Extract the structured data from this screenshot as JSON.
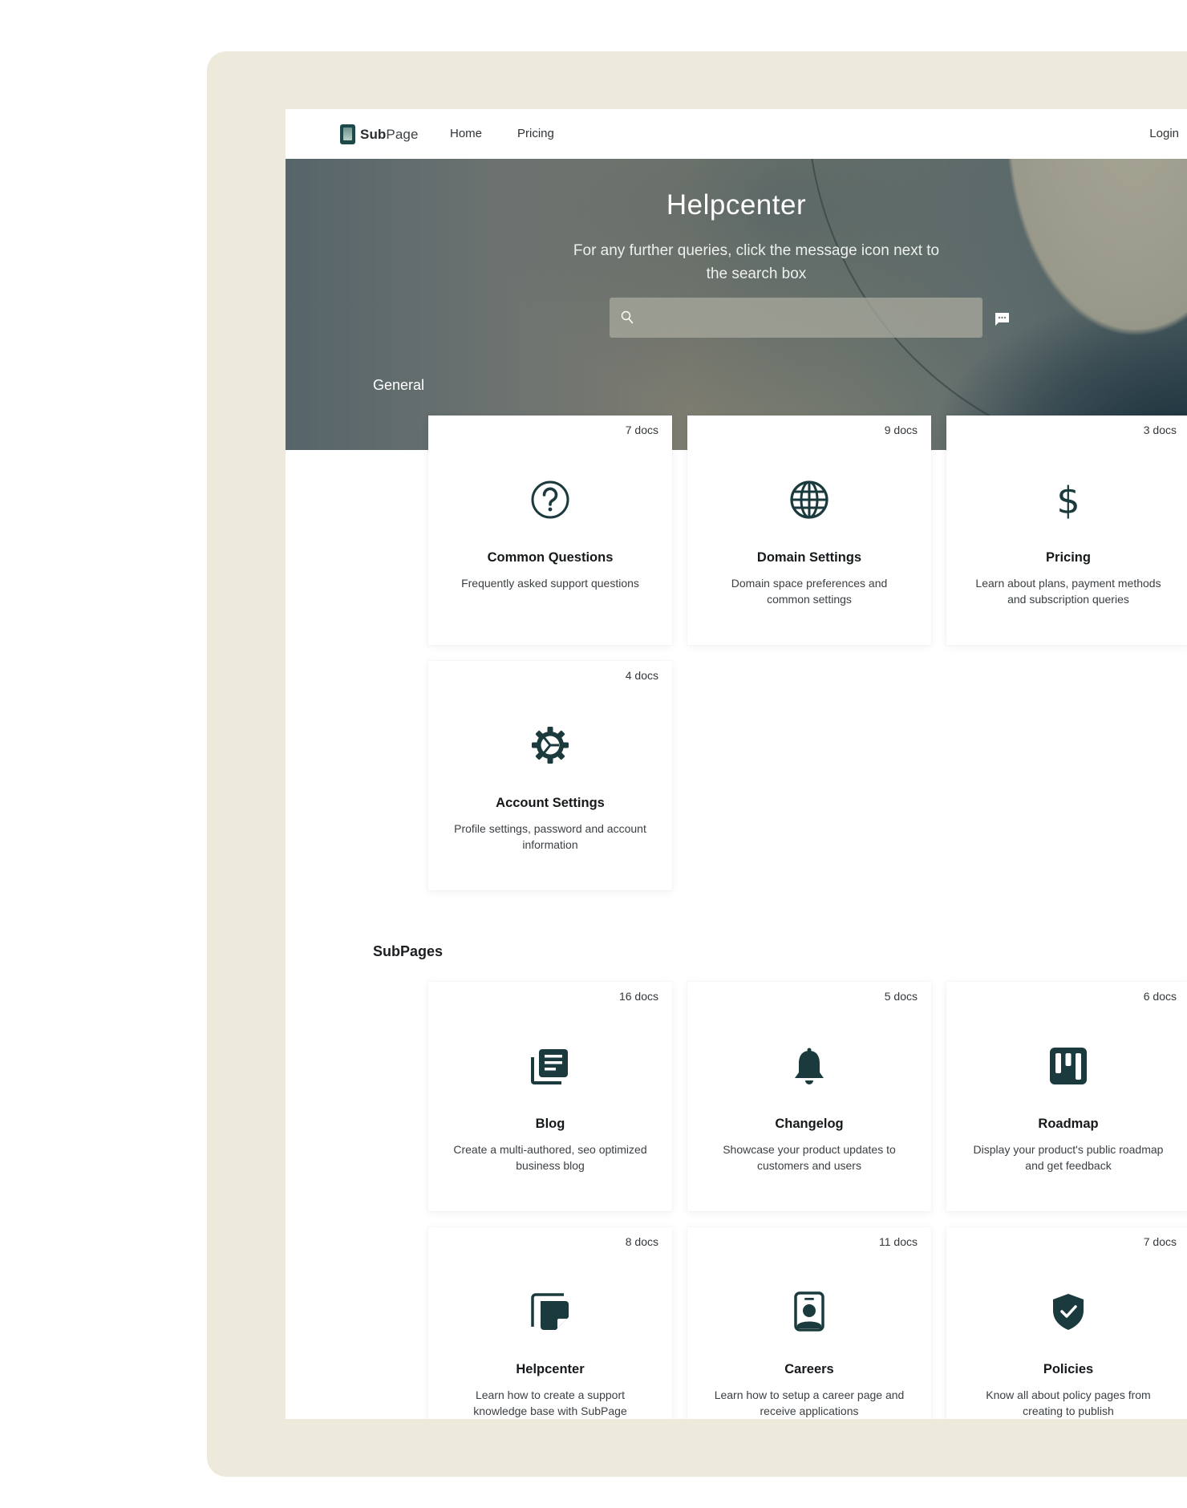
{
  "nav": {
    "logo_bold": "Sub",
    "logo_light": "Page",
    "links": [
      "Home",
      "Pricing"
    ],
    "login": "Login"
  },
  "hero": {
    "title": "Helpcenter",
    "subtitle": "For any further queries, click the message icon next to the search box",
    "search_placeholder": "",
    "search_value": "",
    "search_icon": "search-icon",
    "message_icon": "message-icon"
  },
  "colors": {
    "frame": "#eeeadb",
    "icon": "#1b3a3d",
    "logo": "#1c4a4b"
  },
  "sections": [
    {
      "title": "General",
      "cards": [
        {
          "count": "7 docs",
          "icon": "question-circle-icon",
          "title": "Common Questions",
          "desc": "Frequently asked support questions"
        },
        {
          "count": "9 docs",
          "icon": "globe-icon",
          "title": "Domain Settings",
          "desc": "Domain space preferences and common settings"
        },
        {
          "count": "3 docs",
          "icon": "dollar-icon",
          "title": "Pricing",
          "desc": "Learn about plans, payment methods and subscription queries"
        },
        {
          "count": "4 docs",
          "icon": "gear-icon",
          "title": "Account Settings",
          "desc": "Profile settings, password and account information"
        }
      ]
    },
    {
      "title": "SubPages",
      "cards": [
        {
          "count": "16 docs",
          "icon": "blog-icon",
          "title": "Blog",
          "desc": "Create a multi-authored, seo optimized business blog"
        },
        {
          "count": "5 docs",
          "icon": "bell-icon",
          "title": "Changelog",
          "desc": "Showcase your product updates to customers and users"
        },
        {
          "count": "6 docs",
          "icon": "roadmap-icon",
          "title": "Roadmap",
          "desc": "Display your product's public roadmap and get feedback"
        },
        {
          "count": "8 docs",
          "icon": "sticky-note-icon",
          "title": "Helpcenter",
          "desc": "Learn how to create a support knowledge base with SubPage"
        },
        {
          "count": "11 docs",
          "icon": "id-badge-icon",
          "title": "Careers",
          "desc": "Learn how to setup a career page and receive applications"
        },
        {
          "count": "7 docs",
          "icon": "shield-check-icon",
          "title": "Policies",
          "desc": "Know all about policy pages from creating to publish"
        }
      ]
    }
  ]
}
